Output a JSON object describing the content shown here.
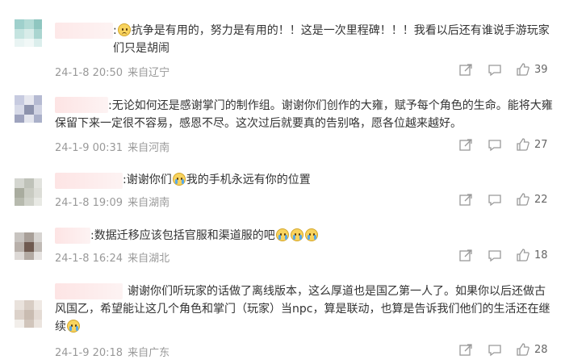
{
  "comments": [
    {
      "text": "抗争是有用的，努力是有用的！！这是一次里程碑！！！我看以后还有谁说手游玩家们只是胡闹",
      "emoji_after_colon": "sad",
      "date": "24-1-8 20:50",
      "location": "来自辽宁",
      "likes": "39"
    },
    {
      "text": "无论如何还是感谢掌门的制作组。谢谢你们创作的大雍，赋予每个角色的生命。能将大雍保留下来一定很不容易，感恩不尽。这次过后就要真的告别咯，愿各位越来越好。",
      "date": "24-1-9 00:31",
      "location": "来自河南",
      "likes": "27"
    },
    {
      "text_before": "谢谢你们",
      "text_after": "我的手机永远有你的位置",
      "date": "24-1-8 19:09",
      "location": "来自湖南",
      "likes": "22"
    },
    {
      "text": "数据迁移应该包括官服和渠道服的吧",
      "date": "24-1-8 16:24",
      "location": "来自湖北",
      "likes": "18"
    },
    {
      "text": "谢谢你们听玩家的话做了离线版本，这么厚道也是国乙第一人了。如果你以后还做古风国乙，希望能让这几个角色和掌门（玩家）当npc，算是联动，也算是告诉我们他们的生活还在继续",
      "date": "24-1-9 20:18",
      "location": "来自广东",
      "likes": "28"
    }
  ],
  "colors": {
    "meta_text": "#999999",
    "body_text": "#333333",
    "name_blur": "#fde4e4"
  },
  "icons": [
    "share-icon",
    "comment-icon",
    "like-icon"
  ]
}
